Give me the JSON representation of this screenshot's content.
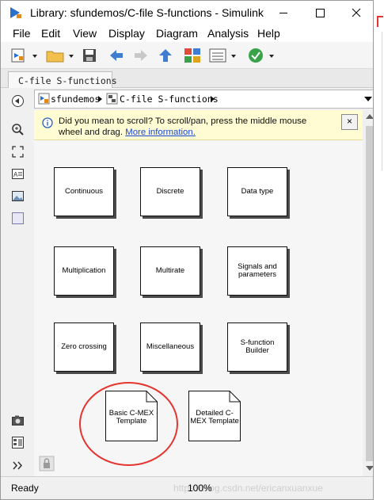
{
  "window": {
    "title": "Library: sfundemos/C-file S-functions - Simulink"
  },
  "menu": [
    "File",
    "Edit",
    "View",
    "Display",
    "Diagram",
    "Analysis",
    "Help"
  ],
  "tab": {
    "label": "C-file S-functions"
  },
  "breadcrumb": {
    "items": [
      "sfundemos",
      "C-file S-functions"
    ]
  },
  "notice": {
    "text": "Did you mean to scroll? To scroll/pan, press the middle mouse wheel and drag.",
    "link": "More information.",
    "close": "×"
  },
  "blocks": [
    {
      "label": "Continuous"
    },
    {
      "label": "Discrete"
    },
    {
      "label": "Data type"
    },
    {
      "label": "Multiplication"
    },
    {
      "label": "Multirate"
    },
    {
      "label": "Signals and parameters"
    },
    {
      "label": "Zero crossing"
    },
    {
      "label": "Miscellaneous"
    },
    {
      "label": "S-function Builder"
    }
  ],
  "templates": [
    {
      "label": "Basic C-MEX Template",
      "highlighted": true
    },
    {
      "label": "Detailed C-MEX Template",
      "highlighted": false
    }
  ],
  "status": {
    "left": "Ready",
    "zoom": "100%",
    "watermark": "https://blog.csdn.net/ericanxuanxue"
  },
  "icons": [
    "simulink-app-icon",
    "minimize-icon",
    "maximize-icon",
    "close-icon",
    "new-model-icon",
    "open-folder-icon",
    "save-icon",
    "back-arrow-icon",
    "forward-arrow-icon",
    "up-arrow-icon",
    "library-browser-icon",
    "model-explorer-icon",
    "check-icon",
    "hide-browser-icon",
    "zoom-icon",
    "fit-view-icon",
    "annotation-icon",
    "image-icon",
    "area-icon",
    "camera-icon",
    "model-browser-icon",
    "expand-icon",
    "lock-icon",
    "info-icon"
  ],
  "colors": {
    "notice_bg": "#fffbd2",
    "link": "#1a46d8",
    "highlight_circle": "#e53530",
    "toolbar_check": "#3aa34a",
    "arrow_blue": "#3f7dd1"
  }
}
